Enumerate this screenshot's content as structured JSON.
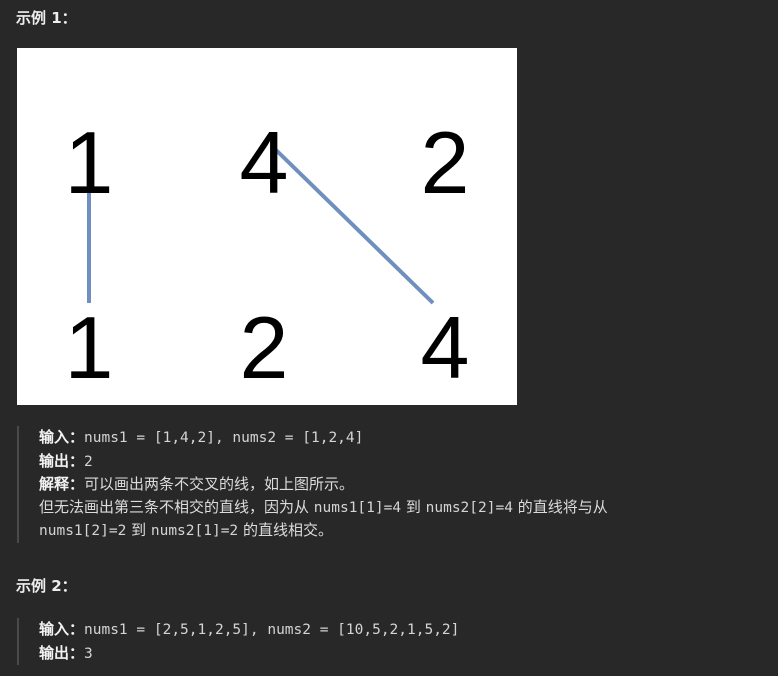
{
  "example1": {
    "title": "示例 1：",
    "figure": {
      "top_row": [
        "1",
        "4",
        "2"
      ],
      "bottom_row": [
        "1",
        "2",
        "4"
      ],
      "connections": [
        [
          0,
          0
        ],
        [
          1,
          2
        ]
      ],
      "line_color": "#6f8fbf"
    },
    "input_label": "输入：",
    "input_value": "nums1 = [1,4,2], nums2 = [1,2,4]",
    "output_label": "输出：",
    "output_value": "2",
    "explain_label": "解释：",
    "explain_line1": "可以画出两条不交叉的线，如上图所示。",
    "explain_line2_a": "但无法画出第三条不相交的直线，因为从 ",
    "explain_line2_code1": "nums1[1]=4",
    "explain_line2_b": " 到 ",
    "explain_line2_code2": "nums2[2]=4",
    "explain_line2_c": " 的直线将与从",
    "explain_line3_code1": "nums1[2]=2",
    "explain_line3_b": " 到 ",
    "explain_line3_code2": "nums2[1]=2",
    "explain_line3_c": " 的直线相交。"
  },
  "example2": {
    "title": "示例 2：",
    "input_label": "输入：",
    "input_value": "nums1 = [2,5,1,2,5], nums2 = [10,5,2,1,5,2]",
    "output_label": "输出：",
    "output_value": "3"
  }
}
